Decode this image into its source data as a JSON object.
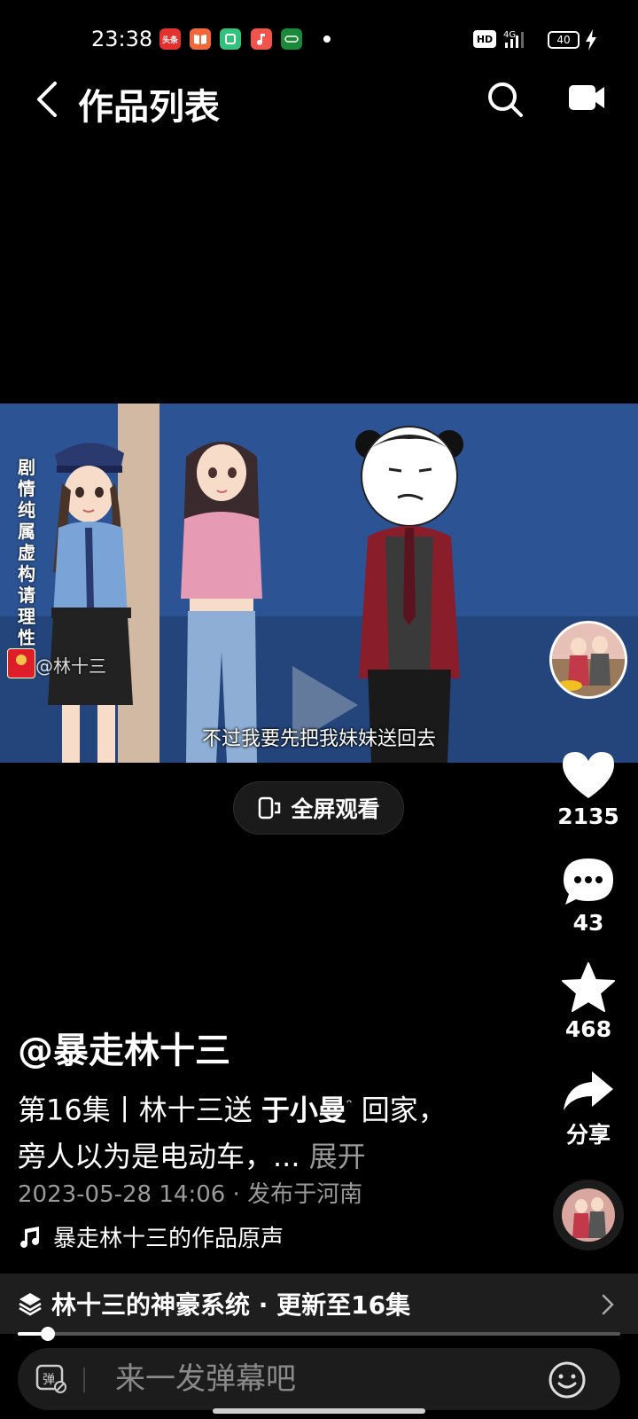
{
  "status_bar": {
    "time": "23:38",
    "notif_toutiao": "头条",
    "network": "4G",
    "hd": "HD",
    "battery": "40"
  },
  "top_bar": {
    "title": "作品列表"
  },
  "video": {
    "disclaimer": "剧情纯属虚构请理性",
    "watermark": "@林十三",
    "subtitle": "不过我要先把我妹妹送回去"
  },
  "fullscreen": {
    "label": "全屏观看"
  },
  "actions": {
    "likes": "2135",
    "comments": "43",
    "favorites": "468",
    "share_label": "分享"
  },
  "post": {
    "author": "@暴走林十三",
    "desc_part1": "第16集丨林十三送 ",
    "desc_tag": "于小曼",
    "desc_part2": " 回家，旁人以为是电动车，... ",
    "expand_label": "展开",
    "date_location": "2023-05-28 14:06 · 发布于河南",
    "music": "暴走林十三的作品原声"
  },
  "collection": {
    "label": "林十三的神豪系统 · 更新至16集",
    "progress": 0.05
  },
  "comment": {
    "placeholder": "来一发弹幕吧"
  },
  "colors": {
    "background": "#000000",
    "video_bg": "#2a4f8f",
    "secondary_text": "#9a9a9a",
    "battery_fill": "#c9b583"
  }
}
